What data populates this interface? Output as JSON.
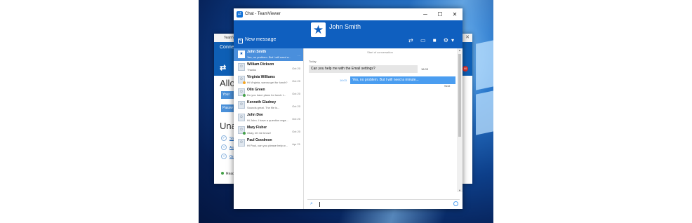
{
  "chat_window": {
    "title": "Chat - TeamViewer",
    "controls": {
      "minimize": "─",
      "maximize": "☐",
      "close": "✕"
    },
    "new_message_label": "New message",
    "contact_name": "John Smith",
    "avatar_glyph": "★",
    "header_icons": "⇄ ▭ ■ ⚙▾"
  },
  "conversations": [
    {
      "name": "John Smith",
      "preview": "Yes, no problem. But I will need a...",
      "date": "",
      "selected": true
    },
    {
      "name": "William Dickson",
      "preview": "Thanks",
      "date": "Oct 20"
    },
    {
      "name": "Virginia Williams",
      "preview": "Hi Virginia, wanna get for lunch?",
      "date": "Oct 20"
    },
    {
      "name": "Olin Green",
      "preview": "Do you have plans for lunch t...",
      "date": "Oct 20"
    },
    {
      "name": "Kenneth Gladney",
      "preview": "Sounds great. The file is...",
      "date": "Oct 20"
    },
    {
      "name": "John Doe",
      "preview": "Hi John. I have a question rega...",
      "date": "Oct 20"
    },
    {
      "name": "Mary Fisher",
      "preview": "Okay, let me know!",
      "date": "Oct 20"
    },
    {
      "name": "Paul Goodmon",
      "preview": "Hi Paul, can you please help w...",
      "date": "Apr 21"
    }
  ],
  "conversation": {
    "start_label": "Start of conversation",
    "day_label": "Today",
    "incoming": {
      "text": "Can you help me with the Email settings?",
      "time": "16:03"
    },
    "outgoing": {
      "text": "Yes, no problem. But I will need a minute...",
      "time": "16:03",
      "status": "Sent"
    },
    "input_value": ""
  },
  "background_window": {
    "title": "TeamViewer",
    "connect_label": "Connect",
    "allow_heading": "Allow",
    "your_id_label": "Your",
    "password_label": "Passw",
    "unattended_heading": "Una",
    "links": [
      "Sta",
      "Ass",
      "Gra"
    ],
    "status_text": "Read",
    "badge": "80"
  }
}
